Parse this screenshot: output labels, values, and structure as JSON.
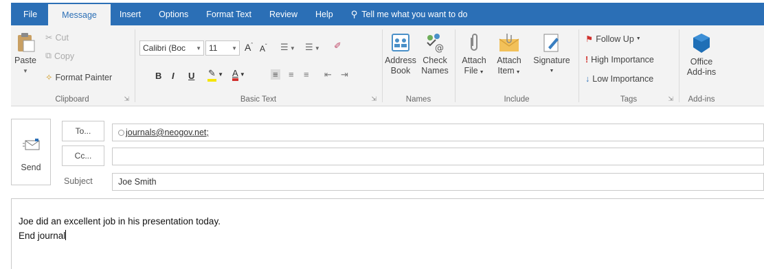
{
  "tabs": [
    {
      "label": "File"
    },
    {
      "label": "Message"
    },
    {
      "label": "Insert"
    },
    {
      "label": "Options"
    },
    {
      "label": "Format Text"
    },
    {
      "label": "Review"
    },
    {
      "label": "Help"
    }
  ],
  "tell_me": "Tell me what you want to do",
  "clipboard": {
    "paste": "Paste",
    "cut": "Cut",
    "copy": "Copy",
    "format_painter": "Format Painter",
    "group_label": "Clipboard"
  },
  "basic_text": {
    "font_name": "Calibri (Boc",
    "font_size": "11",
    "bold": "B",
    "italic": "I",
    "underline": "U",
    "group_label": "Basic Text"
  },
  "names": {
    "address_book_line1": "Address",
    "address_book_line2": "Book",
    "check_names_line1": "Check",
    "check_names_line2": "Names",
    "group_label": "Names"
  },
  "include": {
    "attach_file_line1": "Attach",
    "attach_file_line2": "File",
    "attach_item_line1": "Attach",
    "attach_item_line2": "Item",
    "signature": "Signature",
    "group_label": "Include"
  },
  "tags": {
    "follow_up": "Follow Up",
    "high_importance": "High Importance",
    "low_importance": "Low Importance",
    "group_label": "Tags"
  },
  "addins": {
    "office_line1": "Office",
    "office_line2": "Add-ins",
    "group_label": "Add-ins"
  },
  "compose": {
    "send": "Send",
    "to_button": "To...",
    "cc_button": "Cc...",
    "subject_label": "Subject",
    "to_value": "journals@neogov.net;",
    "cc_value": "",
    "subject_value": "Joe Smith",
    "body_line1": "Joe did an excellent job in his presentation today.",
    "body_line2": "End journal"
  },
  "colors": {
    "tab_bar": "#2b6fb6",
    "ribbon_bg": "#f3f3f3",
    "highlight_yellow": "#f5e50a",
    "font_color_red": "#d0312d"
  }
}
